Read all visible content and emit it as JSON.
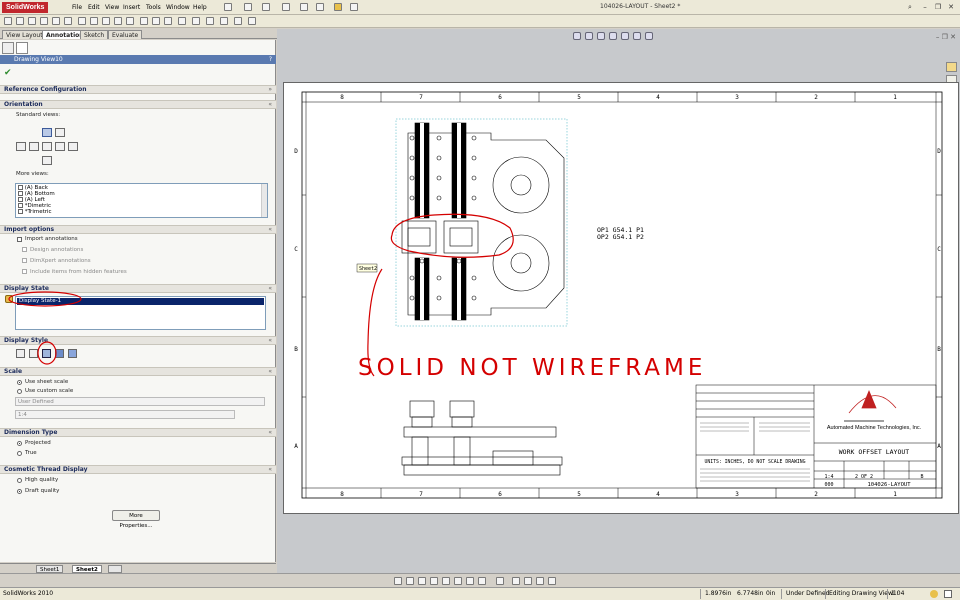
{
  "app": {
    "name": "SolidWorks",
    "document_title": "104026-LAYOUT - Sheet2 *"
  },
  "menu": [
    "File",
    "Edit",
    "View",
    "Insert",
    "Tools",
    "Window",
    "Help"
  ],
  "command_tabs": [
    "View Layout",
    "Annotation",
    "Sketch",
    "Evaluate"
  ],
  "property_manager": {
    "title": "Drawing View10",
    "help": "?",
    "sections": {
      "reference": "Reference Configuration",
      "orientation": "Orientation",
      "import": "Import options",
      "display_state": "Display State",
      "display_style": "Display Style",
      "scale": "Scale",
      "dimension_type": "Dimension Type",
      "cosmetic": "Cosmetic Thread Display"
    },
    "standard_views_label": "Standard views:",
    "more_views_label": "More views:",
    "more_views": [
      "(A) Back",
      "(A) Bottom",
      "(A) Left",
      "*Dimetric",
      "*Trimetric"
    ],
    "import_annotations": "Import annotations",
    "design_annotations": "Design annotations",
    "dimxpert_annotations": "DimXpert annotations",
    "include_hidden": "Include items from hidden features",
    "display_state_value": "Display State-1",
    "scale_sheet": "Use sheet scale",
    "scale_custom": "Use custom scale",
    "scale_user_defined": "User Defined",
    "scale_value": "1:4",
    "dim_projected": "Projected",
    "dim_true": "True",
    "thread_high": "High quality",
    "thread_draft": "Draft quality",
    "more_properties": "More Properties..."
  },
  "sheet_tabs": [
    "Sheet1",
    "Sheet2"
  ],
  "drawing": {
    "columns": [
      "8",
      "7",
      "6",
      "5",
      "4",
      "3",
      "2",
      "1"
    ],
    "rows": [
      "D",
      "C",
      "B",
      "A"
    ],
    "tooltip": "Sheet2",
    "annotation_handwritten": "SOLID NOT WIREFRAME",
    "op_notes": [
      "OP1 G54.1 P1",
      "OP2 G54.1 P2"
    ],
    "title_block": {
      "company": "Automated Machine Technologies, Inc.",
      "title": "WORK OFFSET LAYOUT",
      "units_note": "UNITS: INCHES, DO NOT SCALE DRAWING",
      "size": "B",
      "sheet": "2 OF 2",
      "scale": "1:4",
      "rev": "000",
      "dwg_no": "104026-LAYOUT"
    }
  },
  "status": {
    "app_version": "SolidWorks 2010",
    "x": "1.8976in",
    "y": "6.7748in",
    "z": "0in",
    "definition": "Under Defined",
    "editing": "Editing Drawing View10",
    "scale": "1 : 4"
  },
  "colors": {
    "accent": "#5a7ab0",
    "selection": "#0a246a",
    "annotation_red": "#d40000"
  }
}
